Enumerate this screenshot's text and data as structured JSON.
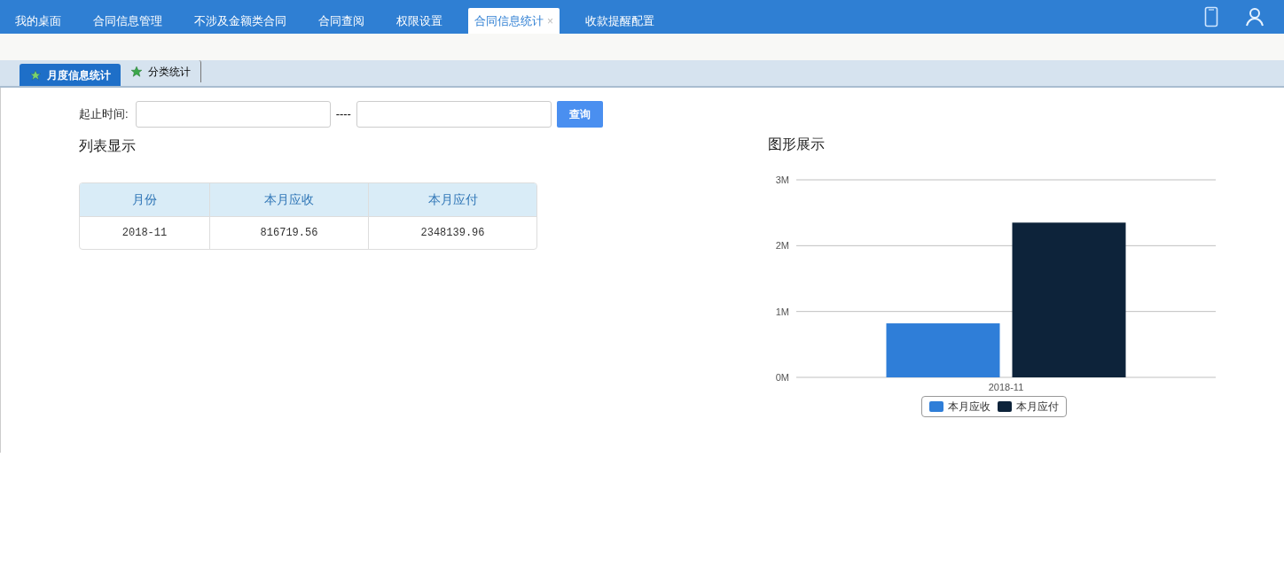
{
  "nav_tabs": [
    {
      "label": "我的桌面",
      "selected": false
    },
    {
      "label": "合同信息管理",
      "selected": false
    },
    {
      "label": "不涉及金额类合同",
      "selected": false
    },
    {
      "label": "合同查阅",
      "selected": false
    },
    {
      "label": "权限设置",
      "selected": false
    },
    {
      "label": "合同信息统计",
      "selected": true,
      "close": "×"
    },
    {
      "label": "收款提醒配置",
      "selected": false
    }
  ],
  "sub_tabs": [
    {
      "label": "月度信息统计",
      "selected": true
    },
    {
      "label": "分类统计",
      "selected": false
    }
  ],
  "filter": {
    "label": "起止时间:",
    "separator": "----",
    "button": "查询"
  },
  "list": {
    "title": "列表显示",
    "columns": [
      "月份",
      "本月应收",
      "本月应付"
    ],
    "rows": [
      [
        "2018-11",
        "816719.56",
        "2348139.96"
      ]
    ]
  },
  "graph": {
    "title": "图形展示",
    "chart_data": {
      "type": "bar",
      "categories": [
        "2018-11"
      ],
      "series": [
        {
          "name": "本月应收",
          "color": "#2f7ed8",
          "values": [
            820000
          ]
        },
        {
          "name": "本月应付",
          "color": "#0d233a",
          "values": [
            2350000
          ]
        }
      ],
      "legend": "bottom",
      "ylim": [
        0,
        3000000
      ],
      "yticks": [
        {
          "value": 0,
          "label": "0M"
        },
        {
          "value": 1000000,
          "label": "1M"
        },
        {
          "value": 2000000,
          "label": "2M"
        },
        {
          "value": 3000000,
          "label": "3M"
        }
      ]
    }
  }
}
